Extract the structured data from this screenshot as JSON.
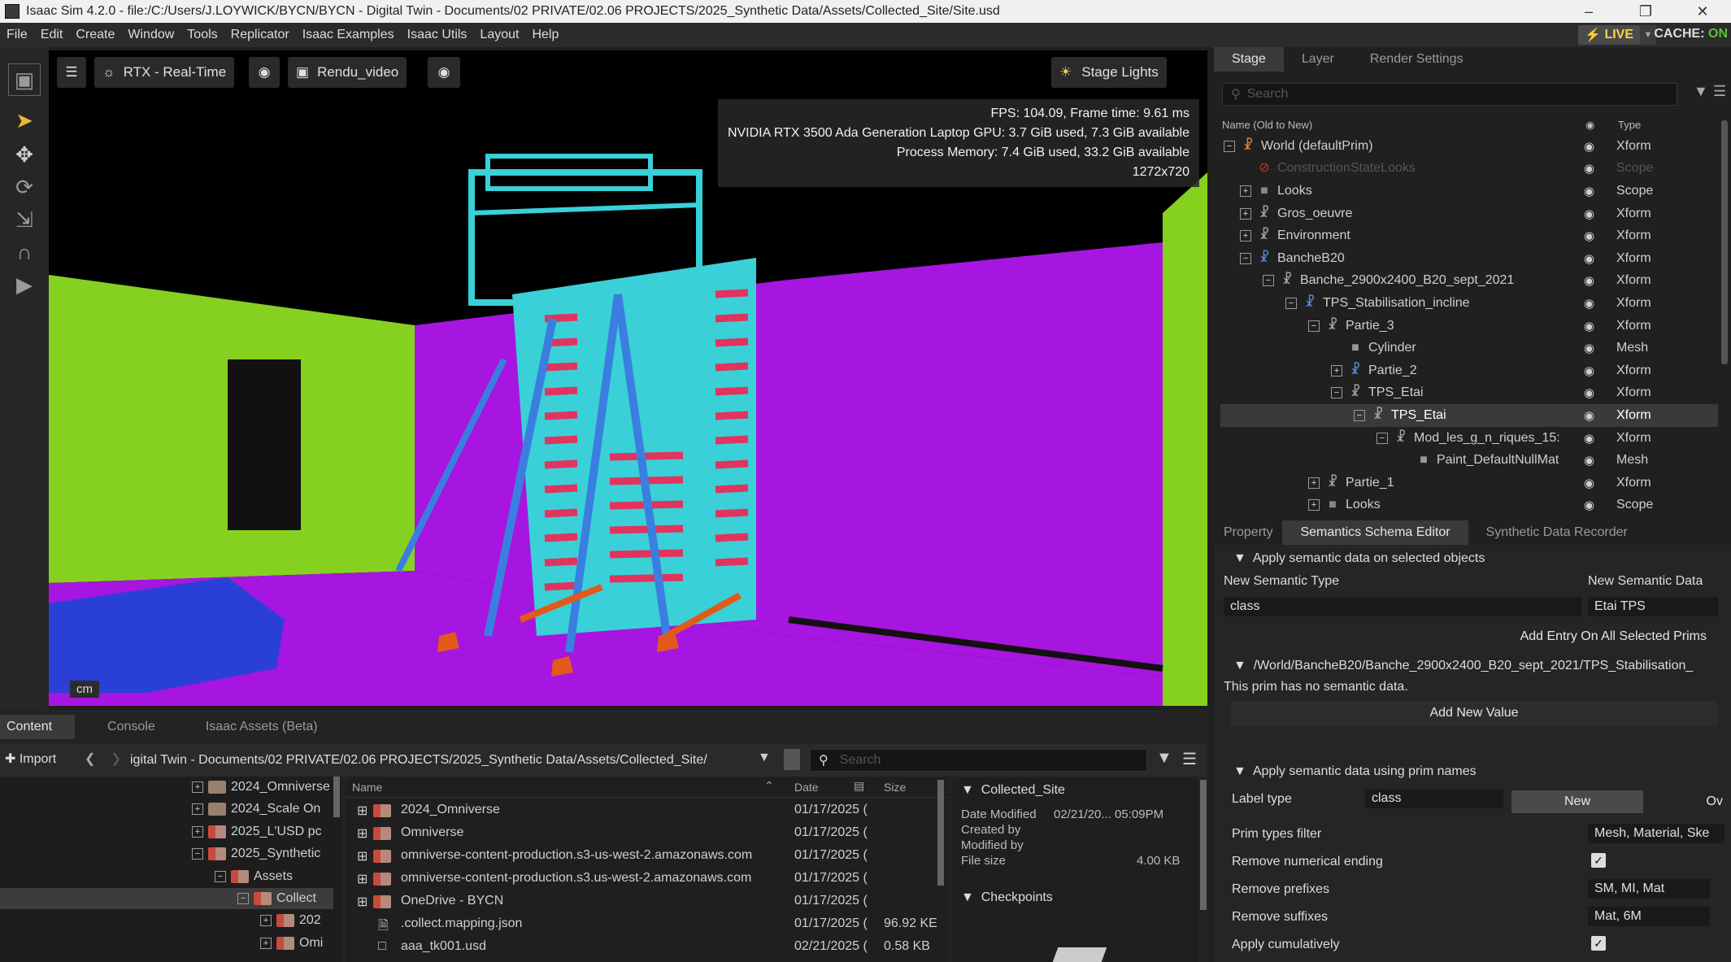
{
  "window": {
    "title": "Isaac Sim 4.2.0 - file:/C:/Users/J.LOYWICK/BYCN/BYCN - Digital Twin - Documents/02 PRIVATE/02.06 PROJECTS/2025_Synthetic Data/Assets/Collected_Site/Site.usd"
  },
  "menu": [
    "File",
    "Edit",
    "Create",
    "Window",
    "Tools",
    "Replicator",
    "Isaac Examples",
    "Isaac Utils",
    "Layout",
    "Help"
  ],
  "live": {
    "label": "LIVE",
    "cache_label": "CACHE:",
    "cache_status": "ON"
  },
  "viewport": {
    "renderer": "RTX - Real-Time",
    "camera": "Rendu_video",
    "lights": "Stage Lights",
    "stats": [
      "FPS: 104.09, Frame time: 9.61 ms",
      "NVIDIA RTX 3500 Ada Generation Laptop GPU: 3.7 GiB used, 7.3 GiB available",
      "Process Memory: 7.4 GiB used, 33.2 GiB available",
      "1272x720"
    ],
    "units": "cm"
  },
  "stage": {
    "tabs": [
      "Stage",
      "Layer",
      "Render Settings"
    ],
    "search_placeholder": "Search",
    "col_name": "Name (Old to New)",
    "col_type": "Type",
    "rows": [
      {
        "name": "World (defaultPrim)",
        "type": "Xform"
      },
      {
        "name": "ConstructionStateLooks",
        "type": "Scope"
      },
      {
        "name": "Looks",
        "type": "Scope"
      },
      {
        "name": "Gros_oeuvre",
        "type": "Xform"
      },
      {
        "name": "Environment",
        "type": "Xform"
      },
      {
        "name": "BancheB20",
        "type": "Xform"
      },
      {
        "name": "Banche_2900x2400_B20_sept_2021",
        "type": "Xform"
      },
      {
        "name": "TPS_Stabilisation_incline",
        "type": "Xform"
      },
      {
        "name": "Partie_3",
        "type": "Xform"
      },
      {
        "name": "Cylinder",
        "type": "Mesh"
      },
      {
        "name": "Partie_2",
        "type": "Xform"
      },
      {
        "name": "TPS_Etai",
        "type": "Xform"
      },
      {
        "name": "TPS_Etai",
        "type": "Xform"
      },
      {
        "name": "Mod_les_g_n_riques_15:",
        "type": "Xform"
      },
      {
        "name": "Paint_DefaultNullMat",
        "type": "Mesh"
      },
      {
        "name": "Partie_1",
        "type": "Xform"
      },
      {
        "name": "Looks",
        "type": "Scope"
      }
    ]
  },
  "props": {
    "tabs": [
      "Property",
      "Semantics Schema Editor",
      "Synthetic Data Recorder"
    ],
    "sec1": "Apply semantic data on selected objects",
    "new_type_label": "New Semantic Type",
    "new_data_label": "New Semantic Data",
    "new_type_value": "class",
    "new_data_value": "Etai TPS",
    "add_all_btn": "Add Entry On All Selected Prims",
    "prim_path": "/World/BancheB20/Banche_2900x2400_B20_sept_2021/TPS_Stabilisation_",
    "no_data": "This prim has no semantic data.",
    "add_value_btn": "Add New Value",
    "sec2": "Apply semantic data using prim names",
    "label_type_label": "Label type",
    "label_type_value": "class",
    "new_btn": "New",
    "ov_btn": "Ov",
    "prim_filter_label": "Prim types filter",
    "prim_filter_value": "Mesh, Material, Ske",
    "remove_num_label": "Remove numerical ending",
    "remove_prefix_label": "Remove prefixes",
    "remove_prefix_value": "SM, MI, Mat",
    "remove_suffix_label": "Remove suffixes",
    "remove_suffix_value": "Mat, 6M",
    "cumulative_label": "Apply cumulatively"
  },
  "content": {
    "tabs": [
      "Content",
      "Console",
      "Isaac Assets (Beta)"
    ],
    "import": "Import",
    "path": "igital Twin - Documents/02 PRIVATE/02.06 PROJECTS/2025_Synthetic Data/Assets/Collected_Site/",
    "search_placeholder": "Search",
    "tree": [
      {
        "name": "2024_Omniverse"
      },
      {
        "name": "2024_Scale On"
      },
      {
        "name": "2025_L'USD pc"
      },
      {
        "name": "2025_Synthetic"
      },
      {
        "name": "Assets"
      },
      {
        "name": "Collect"
      },
      {
        "name": "202"
      },
      {
        "name": "Omi"
      }
    ],
    "col_name": "Name",
    "col_date": "Date",
    "col_size": "Size",
    "files": [
      {
        "name": "2024_Omniverse",
        "date": "01/17/2025 (",
        "size": ""
      },
      {
        "name": "Omniverse",
        "date": "01/17/2025 (",
        "size": ""
      },
      {
        "name": "omniverse-content-production.s3-us-west-2.amazonaws.com",
        "date": "01/17/2025 (",
        "size": ""
      },
      {
        "name": "omniverse-content-production.s3.us-west-2.amazonaws.com",
        "date": "01/17/2025 (",
        "size": ""
      },
      {
        "name": "OneDrive - BYCN",
        "date": "01/17/2025 (",
        "size": ""
      },
      {
        "name": ".collect.mapping.json",
        "date": "01/17/2025 (",
        "size": "96.92 KE"
      },
      {
        "name": "aaa_tk001.usd",
        "date": "02/21/2025 (",
        "size": "0.58 KB"
      }
    ],
    "detail_title": "Collected_Site",
    "date_modified_label": "Date Modified",
    "date_modified_value": "02/21/20... 05:09PM",
    "created_by_label": "Created by",
    "modified_by_label": "Modified by",
    "file_size_label": "File size",
    "file_size_value": "4.00 KB",
    "checkpoints": "Checkpoints"
  }
}
